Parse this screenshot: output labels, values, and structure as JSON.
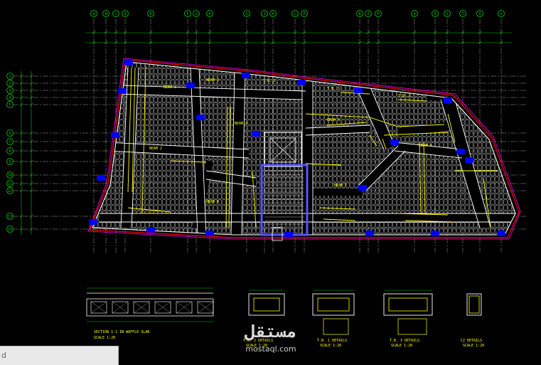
{
  "colors": {
    "background": "#000000",
    "grid": "#9a9a9a",
    "slab_outline": "#ffffff",
    "beams": "#ffff00",
    "column": "#0000ff",
    "boundary_red": "#ff0000",
    "boundary_mag": "#ff00ff",
    "dim": "#00c000",
    "stair": "#5555ff"
  },
  "grid": {
    "top_axes": [
      "A",
      "B",
      "C",
      "D",
      "E",
      "F",
      "G",
      "H",
      "I",
      "J",
      "K",
      "L",
      "M",
      "N",
      "O",
      "P",
      "Q",
      "R",
      "S",
      "T",
      "U",
      "V"
    ],
    "left_axes": [
      "1",
      "2",
      "3",
      "4",
      "5",
      "6",
      "7",
      "8",
      "9",
      "10",
      "11",
      "12",
      "13",
      "14"
    ]
  },
  "plan": {
    "beam_labels": [
      "BEAM 1",
      "BEAM 2",
      "BEAM 3",
      "BEAM 4",
      "BEAM 5",
      "BEAM 6",
      "BEAM 7",
      "BEAM 8",
      "T.B. 1",
      "T.B. 2",
      "T.B. 3"
    ]
  },
  "details": {
    "section_title": "SECTION 1-1 IN WAFFLE SLAB",
    "section_scale": "SCALE 1:20",
    "detail_1_title": "T.B. 2 DETAILS",
    "detail_1_scale": "SCALE 1:20",
    "detail_2_title": "T.B. 1 DETAILS",
    "detail_2_scale": "SCALE 1:20",
    "detail_3_title": "T.B. 3 DETAILS",
    "detail_3_scale": "SCALE 1:20",
    "detail_4_title": "C2 DETAILS",
    "detail_4_scale": "SCALE 1:20"
  },
  "watermark": {
    "logo": "مستقل",
    "site": "mostaql.com"
  },
  "command_line": {
    "text": "d"
  }
}
